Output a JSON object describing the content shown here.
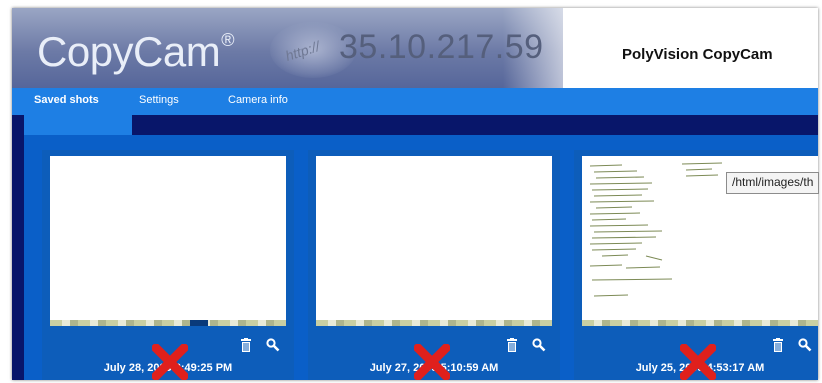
{
  "header": {
    "logo_text": "CopyCam",
    "logo_mark": "®",
    "ip_badge_text": "http://",
    "ip_address": "35.10.217.59",
    "product_name": "PolyVision CopyCam"
  },
  "nav": {
    "tabs": [
      {
        "label": "Saved shots",
        "active": true
      },
      {
        "label": "Settings",
        "active": false
      },
      {
        "label": "Camera info",
        "active": false
      }
    ]
  },
  "shots": [
    {
      "caption": "July 28, 2005 3:49:25 PM",
      "content": "blank",
      "icons": [
        "trash-icon",
        "magnifier-icon",
        "red-x-icon"
      ]
    },
    {
      "caption": "July 27, 2005 5:10:59 AM",
      "content": "blank",
      "icons": [
        "trash-icon",
        "magnifier-icon",
        "red-x-icon"
      ]
    },
    {
      "caption": "July 25, 2005 4:53:17 AM",
      "content": "handwritten-notes",
      "icons": [
        "trash-icon",
        "magnifier-icon",
        "red-x-icon"
      ]
    }
  ],
  "tooltip": {
    "text": "/html/images/th"
  },
  "colors": {
    "header_gradient_top": "#9aa6c4",
    "nav_blue": "#1e7fe4",
    "dark_navy": "#08166a",
    "panel_blue": "#0a5fc8",
    "delete_red": "#e0201c"
  }
}
